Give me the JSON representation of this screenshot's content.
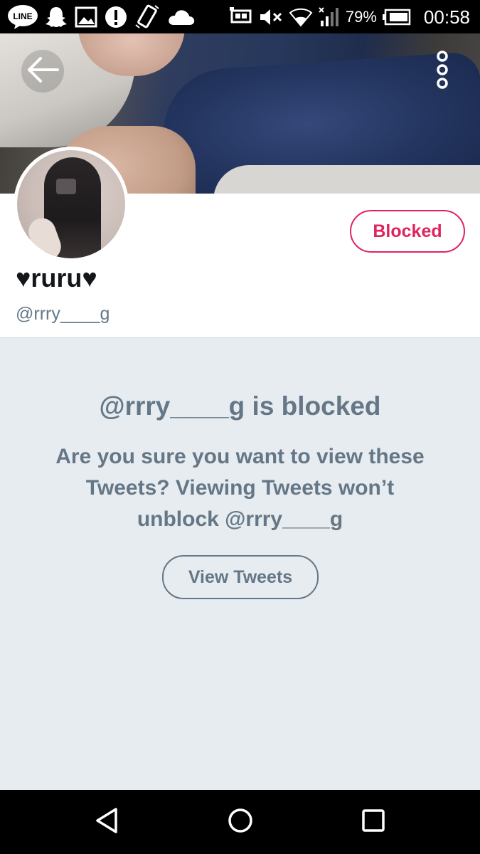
{
  "status_bar": {
    "battery_percent": "79%",
    "time": "00:58",
    "notification_icons": [
      "line-icon",
      "snapchat-icon",
      "image-icon",
      "alert-icon",
      "screen-rotate-icon",
      "cloud-icon"
    ],
    "system_icons": [
      "cast-icon",
      "mute-icon",
      "wifi-icon",
      "signal-icon",
      "battery-icon"
    ],
    "line_icon_text": "LINE"
  },
  "header": {
    "back_icon": "back-arrow-icon",
    "more_icon": "more-vertical-icon"
  },
  "profile": {
    "display_name": "♥ruru♥",
    "handle": "@rrry____g",
    "blocked_label": "Blocked"
  },
  "blocked_notice": {
    "title": "@rrry____g is blocked",
    "description": "Are you sure you want to view these Tweets? Viewing Tweets won’t unblock @rrry____g",
    "view_button_label": "View Tweets"
  },
  "nav_bar": {
    "items": [
      "back-triangle-icon",
      "home-circle-icon",
      "recents-square-icon"
    ]
  },
  "colors": {
    "accent_red": "#e0245e",
    "muted_gray": "#657786",
    "background": "#e6ecf0"
  }
}
